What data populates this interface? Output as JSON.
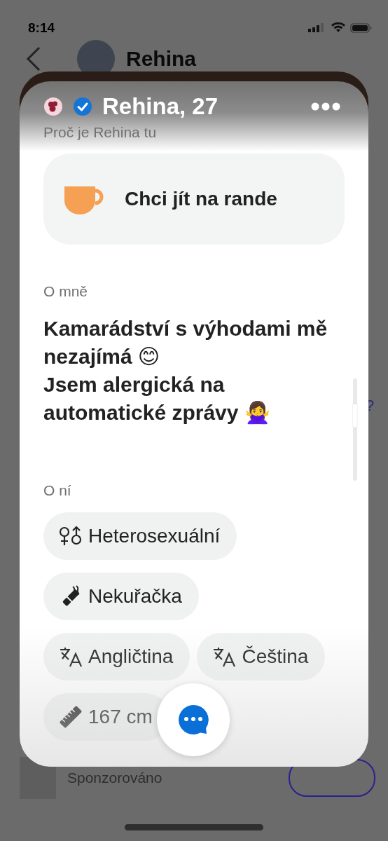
{
  "status_bar": {
    "time": "8:14"
  },
  "background": {
    "title": "Rehina",
    "question_mark": "?",
    "sponsored": "Sponzorováno"
  },
  "profile": {
    "name_age": "Rehina, 27",
    "verified": true
  },
  "intent": {
    "heading": "Proč je Rehina tu",
    "label": "Chci jít na rande"
  },
  "about": {
    "heading": "O mně",
    "lines": [
      "Kamarádství s výhodami mě nezajímá 😊",
      "Jsem alergická na automatické zprávy 🙅‍♀️"
    ]
  },
  "details": {
    "heading": "O ní",
    "chips": [
      {
        "kind": "orientation",
        "label": "Heterosexuální"
      },
      {
        "kind": "smoking",
        "label": "Nekuřačka"
      },
      {
        "kind": "language",
        "label": "Angličtina"
      },
      {
        "kind": "language",
        "label": "Čeština"
      },
      {
        "kind": "height",
        "label": "167 cm"
      }
    ]
  }
}
